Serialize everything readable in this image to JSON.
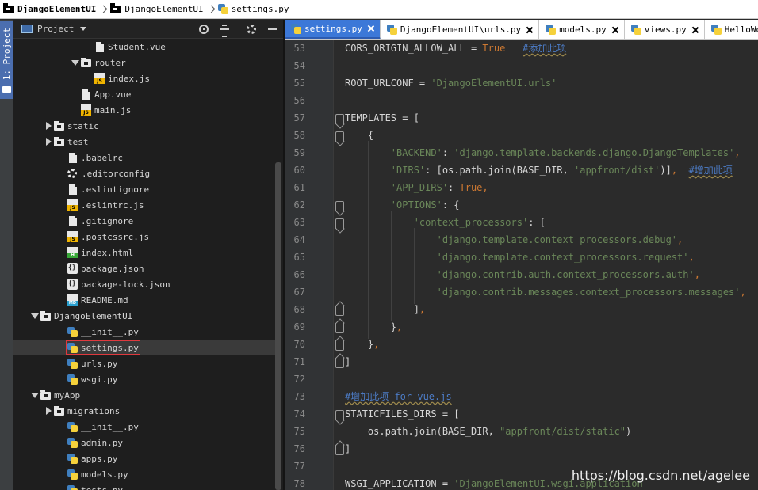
{
  "breadcrumb": [
    {
      "label": "DjangoElementUI",
      "icon": "folder-icon",
      "bold": true
    },
    {
      "label": "DjangoElementUI",
      "icon": "folder-icon",
      "bold": false
    },
    {
      "label": "settings.py",
      "icon": "python-file-icon",
      "bold": false
    }
  ],
  "toolstrip": {
    "project_tab_label": "1: Project"
  },
  "project_panel": {
    "header_label": "Project",
    "buttons": [
      "locate-icon",
      "collapse-all-icon",
      "settings-icon",
      "hide-icon"
    ]
  },
  "tree": [
    {
      "label": "Student.vue",
      "depth": 5,
      "icon": "page",
      "arrow": "none"
    },
    {
      "label": "router",
      "depth": 4,
      "icon": "folder",
      "arrow": "down"
    },
    {
      "label": "index.js",
      "depth": 5,
      "icon": "js",
      "arrow": "none"
    },
    {
      "label": "App.vue",
      "depth": 4,
      "icon": "page",
      "arrow": "none"
    },
    {
      "label": "main.js",
      "depth": 4,
      "icon": "js",
      "arrow": "none"
    },
    {
      "label": "static",
      "depth": 2,
      "icon": "folder",
      "arrow": "right"
    },
    {
      "label": "test",
      "depth": 2,
      "icon": "folder",
      "arrow": "right"
    },
    {
      "label": ".babelrc",
      "depth": 3,
      "icon": "page",
      "arrow": "none"
    },
    {
      "label": ".editorconfig",
      "depth": 3,
      "icon": "gear-f",
      "arrow": "none"
    },
    {
      "label": ".eslintignore",
      "depth": 3,
      "icon": "page",
      "arrow": "none"
    },
    {
      "label": ".eslintrc.js",
      "depth": 3,
      "icon": "js",
      "arrow": "none"
    },
    {
      "label": ".gitignore",
      "depth": 3,
      "icon": "page",
      "arrow": "none"
    },
    {
      "label": ".postcssrc.js",
      "depth": 3,
      "icon": "js",
      "arrow": "none"
    },
    {
      "label": "index.html",
      "depth": 3,
      "icon": "html",
      "arrow": "none"
    },
    {
      "label": "package.json",
      "depth": 3,
      "icon": "json",
      "arrow": "none"
    },
    {
      "label": "package-lock.json",
      "depth": 3,
      "icon": "json",
      "arrow": "none"
    },
    {
      "label": "README.md",
      "depth": 3,
      "icon": "md",
      "arrow": "none"
    },
    {
      "label": "DjangoElementUI",
      "depth": 1,
      "icon": "folder",
      "arrow": "down"
    },
    {
      "label": "__init__.py",
      "depth": 3,
      "icon": "py",
      "arrow": "none"
    },
    {
      "label": "settings.py",
      "depth": 3,
      "icon": "py",
      "arrow": "none",
      "selected": true
    },
    {
      "label": "urls.py",
      "depth": 3,
      "icon": "py",
      "arrow": "none"
    },
    {
      "label": "wsgi.py",
      "depth": 3,
      "icon": "py",
      "arrow": "none"
    },
    {
      "label": "myApp",
      "depth": 1,
      "icon": "folder",
      "arrow": "down"
    },
    {
      "label": "migrations",
      "depth": 2,
      "icon": "folder",
      "arrow": "right"
    },
    {
      "label": "__init__.py",
      "depth": 3,
      "icon": "py",
      "arrow": "none"
    },
    {
      "label": "admin.py",
      "depth": 3,
      "icon": "py",
      "arrow": "none"
    },
    {
      "label": "apps.py",
      "depth": 3,
      "icon": "py",
      "arrow": "none"
    },
    {
      "label": "models.py",
      "depth": 3,
      "icon": "py",
      "arrow": "none"
    },
    {
      "label": "tests.py",
      "depth": 3,
      "icon": "py",
      "arrow": "none"
    }
  ],
  "tabs": [
    {
      "label": "settings.py",
      "active": true
    },
    {
      "label": "DjangoElementUI\\urls.py",
      "active": false
    },
    {
      "label": "models.py",
      "active": false
    },
    {
      "label": "views.py",
      "active": false
    },
    {
      "label": "HelloWorld.",
      "active": false
    }
  ],
  "code_lines": [
    {
      "n": "53",
      "fold": "",
      "tokens": [
        [
          "n",
          "CORS_ORIGIN_ALLOW_ALL"
        ],
        [
          "n",
          " = "
        ],
        [
          "k",
          "True"
        ],
        [
          "n",
          "   "
        ],
        [
          "cb",
          "#添加此项"
        ]
      ]
    },
    {
      "n": "54",
      "fold": "",
      "tokens": []
    },
    {
      "n": "55",
      "fold": "",
      "tokens": [
        [
          "n",
          "ROOT_URLCONF = "
        ],
        [
          "s",
          "'DjangoElementUI.urls'"
        ]
      ]
    },
    {
      "n": "56",
      "fold": "",
      "tokens": []
    },
    {
      "n": "57",
      "fold": "open",
      "tokens": [
        [
          "n",
          "TEMPLATES = ["
        ]
      ]
    },
    {
      "n": "58",
      "fold": "open",
      "tokens": [
        [
          "n",
          "    {"
        ]
      ]
    },
    {
      "n": "59",
      "fold": "",
      "tokens": [
        [
          "n",
          "        "
        ],
        [
          "s",
          "'BACKEND'"
        ],
        [
          "n",
          ": "
        ],
        [
          "s",
          "'django.template.backends.django.DjangoTemplates'"
        ],
        [
          "o",
          ","
        ]
      ]
    },
    {
      "n": "60",
      "fold": "",
      "tokens": [
        [
          "n",
          "        "
        ],
        [
          "s",
          "'DIRS'"
        ],
        [
          "n",
          ": [os.path.join(BASE_DIR, "
        ],
        [
          "s",
          "'appfront/dist'"
        ],
        [
          "n",
          ")]"
        ],
        [
          "o",
          ","
        ],
        [
          "n",
          "  "
        ],
        [
          "cb",
          "#增加此项"
        ]
      ]
    },
    {
      "n": "61",
      "fold": "",
      "tokens": [
        [
          "n",
          "        "
        ],
        [
          "s",
          "'APP_DIRS'"
        ],
        [
          "n",
          ": "
        ],
        [
          "k",
          "True"
        ],
        [
          "o",
          ","
        ]
      ]
    },
    {
      "n": "62",
      "fold": "open",
      "tokens": [
        [
          "n",
          "        "
        ],
        [
          "s",
          "'OPTIONS'"
        ],
        [
          "n",
          ": {"
        ]
      ]
    },
    {
      "n": "63",
      "fold": "open",
      "tokens": [
        [
          "n",
          "            "
        ],
        [
          "s",
          "'context_processors'"
        ],
        [
          "n",
          ": ["
        ]
      ]
    },
    {
      "n": "64",
      "fold": "",
      "tokens": [
        [
          "n",
          "                "
        ],
        [
          "s",
          "'django.template.context_processors.debug'"
        ],
        [
          "o",
          ","
        ]
      ]
    },
    {
      "n": "65",
      "fold": "",
      "tokens": [
        [
          "n",
          "                "
        ],
        [
          "s",
          "'django.template.context_processors.request'"
        ],
        [
          "o",
          ","
        ]
      ]
    },
    {
      "n": "66",
      "fold": "",
      "tokens": [
        [
          "n",
          "                "
        ],
        [
          "s",
          "'django.contrib.auth.context_processors.auth'"
        ],
        [
          "o",
          ","
        ]
      ]
    },
    {
      "n": "67",
      "fold": "",
      "tokens": [
        [
          "n",
          "                "
        ],
        [
          "s",
          "'django.contrib.messages.context_processors.messages'"
        ],
        [
          "o",
          ","
        ]
      ]
    },
    {
      "n": "68",
      "fold": "close",
      "tokens": [
        [
          "n",
          "            ]"
        ],
        [
          "o",
          ","
        ]
      ]
    },
    {
      "n": "69",
      "fold": "close",
      "tokens": [
        [
          "n",
          "        }"
        ],
        [
          "o",
          ","
        ]
      ]
    },
    {
      "n": "70",
      "fold": "close",
      "tokens": [
        [
          "n",
          "    }"
        ],
        [
          "o",
          ","
        ]
      ]
    },
    {
      "n": "71",
      "fold": "close",
      "tokens": [
        [
          "n",
          "]"
        ]
      ]
    },
    {
      "n": "72",
      "fold": "",
      "tokens": []
    },
    {
      "n": "73",
      "fold": "",
      "tokens": [
        [
          "cb",
          "#增加此项 for vue.js"
        ]
      ]
    },
    {
      "n": "74",
      "fold": "open",
      "tokens": [
        [
          "n",
          "STATICFILES_DIRS = ["
        ]
      ]
    },
    {
      "n": "75",
      "fold": "",
      "tokens": [
        [
          "n",
          "    os.path.join(BASE_DIR, "
        ],
        [
          "s",
          "\"appfront/dist/static\""
        ],
        [
          "n",
          ")"
        ]
      ]
    },
    {
      "n": "76",
      "fold": "close",
      "tokens": [
        [
          "n",
          "]"
        ]
      ]
    },
    {
      "n": "77",
      "fold": "",
      "tokens": []
    },
    {
      "n": "78",
      "fold": "",
      "tokens": [
        [
          "n",
          "WSGI_APPLICATION = "
        ],
        [
          "s",
          "'DjangoElementUI.wsgi.application"
        ]
      ]
    }
  ],
  "watermark": "https://blog.csdn.net/agelee",
  "colors": {
    "accent": "#3c78d8",
    "string": "#6a8759",
    "keyword": "#cc7832",
    "comment": "#4d7dc8",
    "selection_border": "#e0393e"
  }
}
